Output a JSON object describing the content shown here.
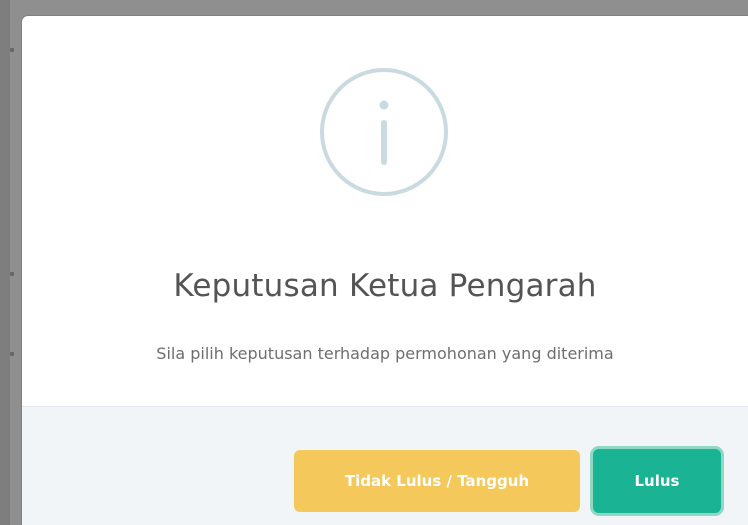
{
  "dialog": {
    "icon": "info-circle-icon",
    "title": "Keputusan Ketua Pengarah",
    "subtitle": "Sila pilih keputusan terhadap permohonan yang diterima",
    "buttons": {
      "reject_label": "Tidak Lulus / Tangguh",
      "approve_label": "Lulus"
    }
  },
  "colors": {
    "icon_stroke": "#c9dae1",
    "reject_button": "#f4c85a",
    "approve_button": "#1ab394",
    "footer_bg": "#f2f5f8"
  }
}
